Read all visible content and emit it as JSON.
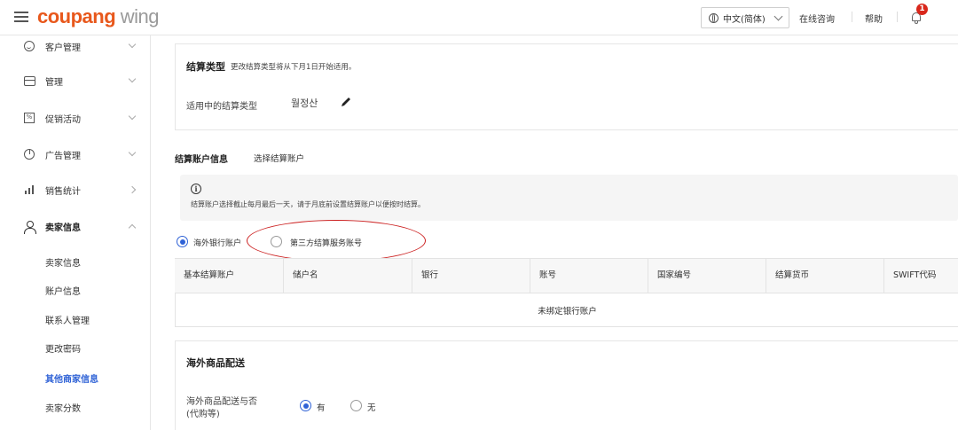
{
  "header": {
    "logo_part1": "coupang",
    "logo_part2": " wing",
    "language": "中文(简体)",
    "links": [
      "在线咨询",
      "帮助"
    ],
    "notification_count": "1"
  },
  "sidebar": {
    "items": [
      {
        "label": "客户管理",
        "icon": "smile-icon"
      },
      {
        "label": "管理",
        "icon": "card-icon"
      },
      {
        "label": "促销活动",
        "icon": "promo-icon"
      },
      {
        "label": "广告管理",
        "icon": "pie-chart-icon"
      },
      {
        "label": "销售统计",
        "icon": "bar-chart-icon"
      },
      {
        "label": "卖家信息",
        "icon": "user-icon"
      }
    ],
    "sub_items": [
      "卖家信息",
      "账户信息",
      "联系人管理",
      "更改密码",
      "其他商家信息",
      "卖家分数"
    ],
    "active_sub": "其他商家信息"
  },
  "settlement_type": {
    "title": "结算类型",
    "note": "更改结算类型将从下月1日开始适用。",
    "current_label": "适用中的结算类型",
    "current_value": "월정산"
  },
  "account_info": {
    "title": "结算账户信息",
    "select_label": "选择结算账户",
    "notice": "结算账户选择截止每月最后一天，请于月底前设置结算账户以便按时结算。",
    "options": [
      {
        "label": "海外银行账户",
        "selected": true
      },
      {
        "label": "第三方结算服务账号",
        "selected": false
      }
    ]
  },
  "table": {
    "columns": [
      "基本结算账户",
      "储户名",
      "银行",
      "账号",
      "国家编号",
      "结算货币",
      "SWIFT代码"
    ],
    "empty_text": "未绑定银行账户"
  },
  "overseas": {
    "title": "海外商品配送",
    "question_line1": "海外商品配送与否",
    "question_line2": "(代购等)",
    "options": [
      {
        "label": "有",
        "selected": true
      },
      {
        "label": "无",
        "selected": false
      }
    ]
  },
  "colors": {
    "brand": "#e8581c",
    "accent": "#2f62d6",
    "annotation": "#cc2222"
  }
}
